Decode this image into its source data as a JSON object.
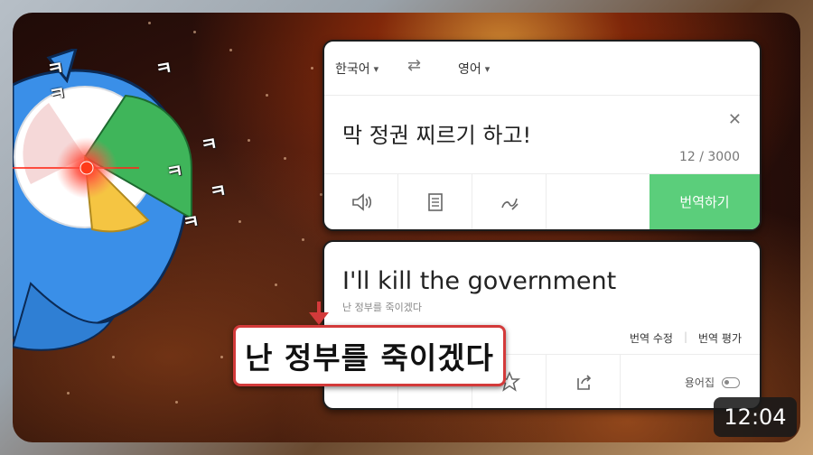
{
  "translator": {
    "source_lang": "한국어",
    "target_lang": "영어",
    "source_text": "막 정권 찌르기 하고!",
    "char_count": "12 / 3000",
    "translate_button": "번역하기",
    "result_text": "I'll kill the government",
    "result_pron": "난 정부를 죽이겠다",
    "edit_translation": "번역 수정",
    "rate_translation": "번역 평가",
    "glossary_label": "용어집"
  },
  "callout_text": "난 정부를 죽이겠다",
  "laugh_marks": [
    "ㅋ",
    "ㅋ",
    "ㅋ",
    "ㅋ",
    "ㅋ",
    "ㅋ",
    "ㅋ"
  ],
  "video_duration": "12:04",
  "colors": {
    "translate_button": "#5bce7b",
    "callout_border": "#d33a3a",
    "bird_body": "#3a8fe8",
    "pie_green": "#3fb55a",
    "pie_yellow": "#f5c542"
  }
}
